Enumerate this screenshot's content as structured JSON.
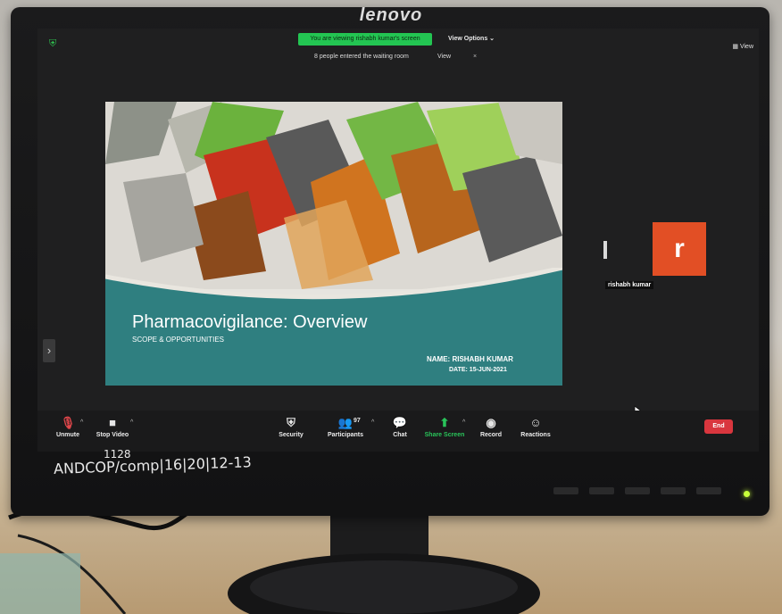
{
  "monitor": {
    "brand": "lenovo",
    "label_handwritten": "ANDCOP/comp|16|20|12-13",
    "label_handwritten_top": "1128"
  },
  "meeting": {
    "share_banner": "You are viewing rishabh kumar's screen",
    "view_options": "View Options ⌄",
    "view_button": "View",
    "waiting_room_text": "8 people entered the waiting room",
    "waiting_view": "View",
    "waiting_close": "×"
  },
  "slide": {
    "title": "Pharmacovigilance: Overview",
    "subtitle": "SCOPE & OPPORTUNITIES",
    "name_line": "NAME: RISHABH KUMAR",
    "date_line": "DATE: 15-JUN-2021"
  },
  "participant": {
    "initial": "r",
    "name": "rishabh kumar"
  },
  "toolbar": {
    "unmute": "Unmute",
    "stop_video": "Stop Video",
    "security": "Security",
    "participants": "Participants",
    "participants_count": "97",
    "chat": "Chat",
    "share_screen": "Share Screen",
    "record": "Record",
    "reactions": "Reactions",
    "end": "End"
  },
  "icons": {
    "shield": "shield-icon",
    "mic_off": "mic-off-icon",
    "video": "video-icon",
    "participants": "participants-icon",
    "chat": "chat-icon",
    "share": "share-screen-icon",
    "record": "record-icon",
    "reactions": "reactions-icon",
    "cursor": "cursor-icon"
  },
  "colors": {
    "share_green": "#23c552",
    "end_red": "#d9363e",
    "avatar_orange": "#e24f25",
    "slide_teal": "#2f7f80"
  }
}
